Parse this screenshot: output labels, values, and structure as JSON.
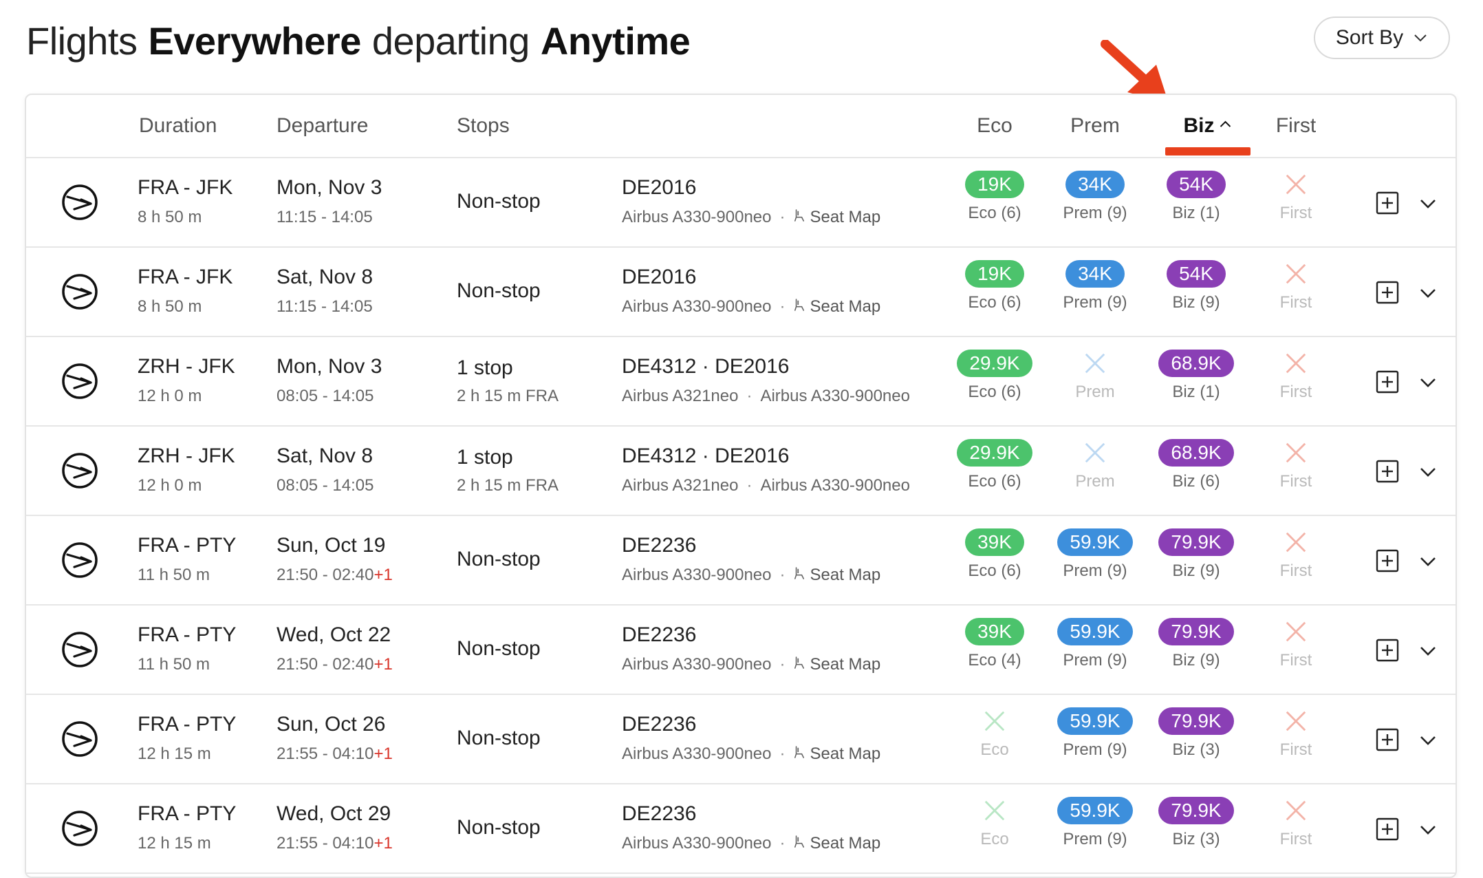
{
  "header": {
    "title_prefix": "Flights",
    "title_destination": "Everywhere",
    "title_middle": "departing",
    "title_when": "Anytime",
    "sort_label": "Sort By"
  },
  "columns": {
    "duration": "Duration",
    "departure": "Departure",
    "stops": "Stops",
    "eco": "Eco",
    "prem": "Prem",
    "biz": "Biz",
    "first": "First",
    "active_sort": "biz"
  },
  "colors": {
    "eco": "#4cc36c",
    "prem": "#3d8fdc",
    "biz": "#8a3fb5",
    "unavailable_x": "#f3b3a8",
    "unavailable_x_eco": "#b8e6c4",
    "unavailable_x_prem": "#bcd8f2",
    "accent": "#e8401c"
  },
  "icons": {
    "airline_logo": "airline-logo-icon",
    "seat_map": "seat-icon",
    "add": "plus-square-icon",
    "expand": "chevron-down-icon",
    "sort": "chevron-down-icon",
    "active_sort_dir": "chevron-up-icon",
    "annotation": "red-arrow-icon"
  },
  "flights": [
    {
      "route": "FRA - JFK",
      "duration": "8 h 50 m",
      "date": "Mon, Nov 3",
      "time": "11:15 - 14:05",
      "plus_day": "",
      "stops": "Non-stop",
      "stop_detail": "",
      "flight_no": "DE2016",
      "aircraft": "Airbus A330-900neo",
      "aircraft2": "",
      "seat_map": "Seat Map",
      "eco": {
        "available": true,
        "price": "19K",
        "label": "Eco (6)"
      },
      "prem": {
        "available": true,
        "price": "34K",
        "label": "Prem (9)"
      },
      "biz": {
        "available": true,
        "price": "54K",
        "label": "Biz (1)"
      },
      "first": {
        "available": false,
        "price": "",
        "label": "First"
      }
    },
    {
      "route": "FRA - JFK",
      "duration": "8 h 50 m",
      "date": "Sat, Nov 8",
      "time": "11:15 - 14:05",
      "plus_day": "",
      "stops": "Non-stop",
      "stop_detail": "",
      "flight_no": "DE2016",
      "aircraft": "Airbus A330-900neo",
      "aircraft2": "",
      "seat_map": "Seat Map",
      "eco": {
        "available": true,
        "price": "19K",
        "label": "Eco (6)"
      },
      "prem": {
        "available": true,
        "price": "34K",
        "label": "Prem (9)"
      },
      "biz": {
        "available": true,
        "price": "54K",
        "label": "Biz (9)"
      },
      "first": {
        "available": false,
        "price": "",
        "label": "First"
      }
    },
    {
      "route": "ZRH - JFK",
      "duration": "12 h 0 m",
      "date": "Mon, Nov 3",
      "time": "08:05 - 14:05",
      "plus_day": "",
      "stops": "1 stop",
      "stop_detail": "2 h 15 m  FRA",
      "flight_no": "DE4312  ·  DE2016",
      "aircraft": "Airbus A321neo",
      "aircraft2": "Airbus A330-900neo",
      "seat_map": "",
      "eco": {
        "available": true,
        "price": "29.9K",
        "label": "Eco (6)"
      },
      "prem": {
        "available": false,
        "price": "",
        "label": "Prem"
      },
      "biz": {
        "available": true,
        "price": "68.9K",
        "label": "Biz (1)"
      },
      "first": {
        "available": false,
        "price": "",
        "label": "First"
      }
    },
    {
      "route": "ZRH - JFK",
      "duration": "12 h 0 m",
      "date": "Sat, Nov 8",
      "time": "08:05 - 14:05",
      "plus_day": "",
      "stops": "1 stop",
      "stop_detail": "2 h 15 m  FRA",
      "flight_no": "DE4312  ·  DE2016",
      "aircraft": "Airbus A321neo",
      "aircraft2": "Airbus A330-900neo",
      "seat_map": "",
      "eco": {
        "available": true,
        "price": "29.9K",
        "label": "Eco (6)"
      },
      "prem": {
        "available": false,
        "price": "",
        "label": "Prem"
      },
      "biz": {
        "available": true,
        "price": "68.9K",
        "label": "Biz (6)"
      },
      "first": {
        "available": false,
        "price": "",
        "label": "First"
      }
    },
    {
      "route": "FRA - PTY",
      "duration": "11 h 50 m",
      "date": "Sun, Oct 19",
      "time": "21:50 - 02:40",
      "plus_day": "+1",
      "stops": "Non-stop",
      "stop_detail": "",
      "flight_no": "DE2236",
      "aircraft": "Airbus A330-900neo",
      "aircraft2": "",
      "seat_map": "Seat Map",
      "eco": {
        "available": true,
        "price": "39K",
        "label": "Eco (6)"
      },
      "prem": {
        "available": true,
        "price": "59.9K",
        "label": "Prem (9)"
      },
      "biz": {
        "available": true,
        "price": "79.9K",
        "label": "Biz (9)"
      },
      "first": {
        "available": false,
        "price": "",
        "label": "First"
      }
    },
    {
      "route": "FRA - PTY",
      "duration": "11 h 50 m",
      "date": "Wed, Oct 22",
      "time": "21:50 - 02:40",
      "plus_day": "+1",
      "stops": "Non-stop",
      "stop_detail": "",
      "flight_no": "DE2236",
      "aircraft": "Airbus A330-900neo",
      "aircraft2": "",
      "seat_map": "Seat Map",
      "eco": {
        "available": true,
        "price": "39K",
        "label": "Eco (4)"
      },
      "prem": {
        "available": true,
        "price": "59.9K",
        "label": "Prem (9)"
      },
      "biz": {
        "available": true,
        "price": "79.9K",
        "label": "Biz (9)"
      },
      "first": {
        "available": false,
        "price": "",
        "label": "First"
      }
    },
    {
      "route": "FRA - PTY",
      "duration": "12 h 15 m",
      "date": "Sun, Oct 26",
      "time": "21:55 - 04:10",
      "plus_day": "+1",
      "stops": "Non-stop",
      "stop_detail": "",
      "flight_no": "DE2236",
      "aircraft": "Airbus A330-900neo",
      "aircraft2": "",
      "seat_map": "Seat Map",
      "eco": {
        "available": false,
        "price": "",
        "label": "Eco"
      },
      "prem": {
        "available": true,
        "price": "59.9K",
        "label": "Prem (9)"
      },
      "biz": {
        "available": true,
        "price": "79.9K",
        "label": "Biz (3)"
      },
      "first": {
        "available": false,
        "price": "",
        "label": "First"
      }
    },
    {
      "route": "FRA - PTY",
      "duration": "12 h 15 m",
      "date": "Wed, Oct 29",
      "time": "21:55 - 04:10",
      "plus_day": "+1",
      "stops": "Non-stop",
      "stop_detail": "",
      "flight_no": "DE2236",
      "aircraft": "Airbus A330-900neo",
      "aircraft2": "",
      "seat_map": "Seat Map",
      "eco": {
        "available": false,
        "price": "",
        "label": "Eco"
      },
      "prem": {
        "available": true,
        "price": "59.9K",
        "label": "Prem (9)"
      },
      "biz": {
        "available": true,
        "price": "79.9K",
        "label": "Biz (3)"
      },
      "first": {
        "available": false,
        "price": "",
        "label": "First"
      }
    }
  ]
}
